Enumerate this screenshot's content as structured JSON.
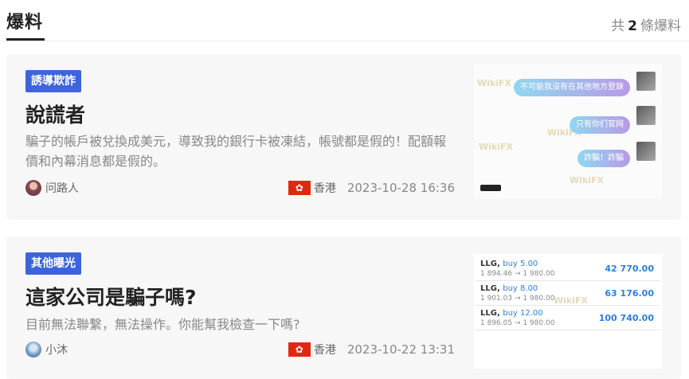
{
  "header": {
    "title": "爆料",
    "count_prefix": "共",
    "count": "2",
    "count_suffix": "條爆料"
  },
  "posts": [
    {
      "tag": "誘導欺詐",
      "title": "說謊者",
      "description": "騙子的帳戶被兌換成美元，導致我的銀行卡被凍結，帳號都是假的！配額報價和內幕消息都是假的。",
      "author": "问路人",
      "region": "香港",
      "time": "2023-10-28 16:36",
      "thumb": {
        "watermark": "WikiFX",
        "bubbles": [
          "不可能我沒有在其他地方登錄",
          "只有你们官网",
          "詐騙！詐騙"
        ]
      }
    },
    {
      "tag": "其他曝光",
      "title": "這家公司是騙子嗎?",
      "description": "目前無法聯繫，無法操作。你能幫我檢查一下嗎?",
      "author": "小沐",
      "region": "香港",
      "time": "2023-10-22 13:31",
      "thumb": {
        "watermark": "WikiFX",
        "trades": [
          {
            "symbol": "LLG,",
            "side": "buy 5.00",
            "prices": "1 894.46 → 1 980.00",
            "profit": "42 770.00"
          },
          {
            "symbol": "LLG,",
            "side": "buy 8.00",
            "prices": "1 901.03 → 1 980.00",
            "profit": "63 176.00"
          },
          {
            "symbol": "LLG,",
            "side": "buy 12.00",
            "prices": "1 896.05 → 1 980.00",
            "profit": "100 740.00"
          }
        ]
      }
    }
  ],
  "colors": {
    "tag_bg": "#3d63dd",
    "flag": "#de2910",
    "profit": "#2b7fd6"
  },
  "icons": {
    "flag": "hong-kong-flag-icon",
    "avatar": "user-avatar-icon"
  }
}
